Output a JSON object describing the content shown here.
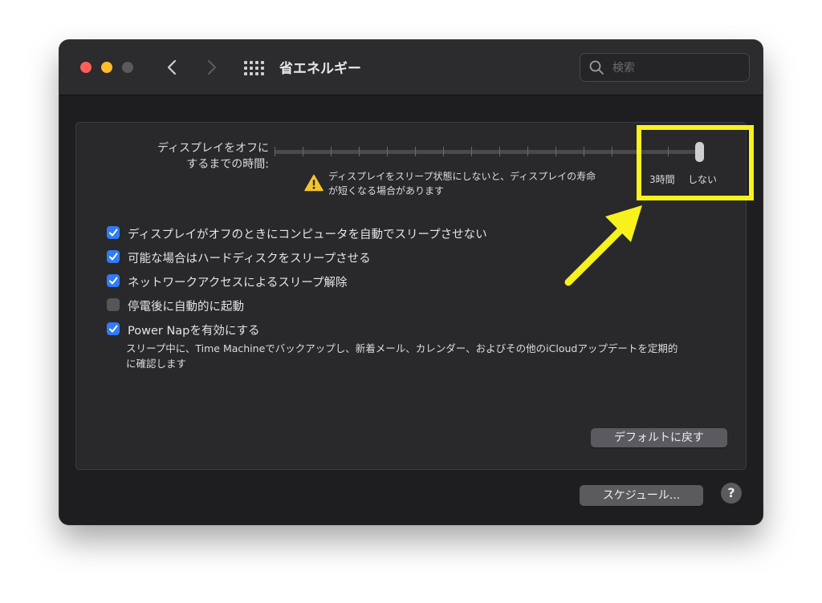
{
  "window": {
    "title": "省エネルギー",
    "search_placeholder": "検索"
  },
  "slider": {
    "label_line1": "ディスプレイをオフに",
    "label_line2": "するまでの時間:",
    "value": "しない",
    "tick_3h": "3時間",
    "tick_never": "しない",
    "warning_line1": "ディスプレイをスリープ状態にしないと、ディスプレイの寿命",
    "warning_line2": "が短くなる場合があります"
  },
  "options": [
    {
      "label": "ディスプレイがオフのときにコンピュータを自動でスリープさせない",
      "checked": true
    },
    {
      "label": "可能な場合はハードディスクをスリープさせる",
      "checked": true
    },
    {
      "label": "ネットワークアクセスによるスリープ解除",
      "checked": true
    },
    {
      "label": "停電後に自動的に起動",
      "checked": false
    },
    {
      "label": "Power Napを有効にする",
      "checked": true
    }
  ],
  "power_nap_description_line1": "スリープ中に、Time Machineでバックアップし、新着メール、カレンダー、およびその他のiCloudアップデートを定期的",
  "power_nap_description_line2": "に確認します",
  "buttons": {
    "restore_defaults": "デフォルトに戻す",
    "schedule": "スケジュール...",
    "help": "?"
  },
  "colors": {
    "accent": "#2f7cf6",
    "annotation": "#f7f21c",
    "window_bg": "#1e1e20"
  }
}
